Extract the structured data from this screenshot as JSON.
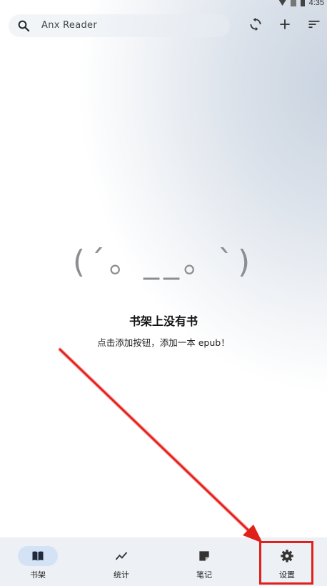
{
  "status_bar": {
    "time": "4:35"
  },
  "search": {
    "label": "Anx Reader",
    "icon": "search-icon"
  },
  "top_actions": [
    {
      "name": "sync-icon"
    },
    {
      "name": "add-icon"
    },
    {
      "name": "sort-icon"
    }
  ],
  "empty_state": {
    "kaomoji": "(´｡ __｡ `)",
    "title": "书架上没有书",
    "subtitle": "点击添加按钮，添加一本 epub！"
  },
  "bottom_nav": {
    "items": [
      {
        "label": "书架",
        "icon": "book-icon",
        "active": true
      },
      {
        "label": "统计",
        "icon": "trend-icon",
        "active": false
      },
      {
        "label": "笔记",
        "icon": "note-icon",
        "active": false
      },
      {
        "label": "设置",
        "icon": "gear-icon",
        "active": false
      }
    ]
  },
  "colors": {
    "accent": "#d4e2f6",
    "annotation_red": "#e0201b",
    "nav_background": "#edf0f4"
  }
}
